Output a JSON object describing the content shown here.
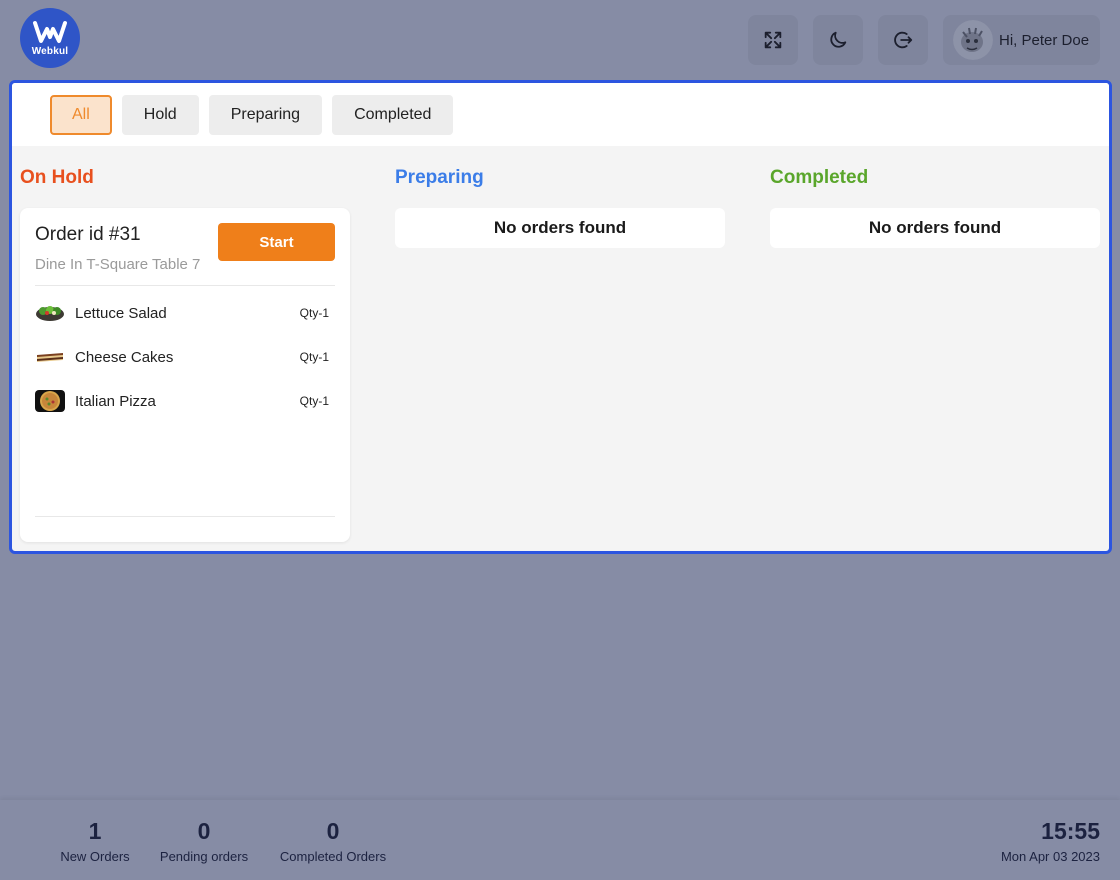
{
  "logo": {
    "text": "Webkul",
    "color": "#2f55c7"
  },
  "header": {
    "buttons": [
      {
        "icon": "fullscreen-icon"
      },
      {
        "icon": "moon-icon"
      },
      {
        "icon": "logout-icon"
      }
    ],
    "user": {
      "greeting": "Hi, Peter Doe",
      "avatar_icon": "user-avatar"
    }
  },
  "tabs": [
    {
      "label": "All",
      "active": true
    },
    {
      "label": "Hold",
      "active": false
    },
    {
      "label": "Preparing",
      "active": false
    },
    {
      "label": "Completed",
      "active": false
    }
  ],
  "columns": {
    "hold": {
      "title": "On Hold",
      "color": "#e8501e"
    },
    "preparing": {
      "title": "Preparing",
      "color": "#3b7de8",
      "empty": "No orders found"
    },
    "completed": {
      "title": "Completed",
      "color": "#5aa62b",
      "empty": "No orders found"
    }
  },
  "order": {
    "id": "Order id #31",
    "subtitle": "Dine In T-Square Table 7",
    "action": "Start",
    "items": [
      {
        "name": "Lettuce Salad",
        "qty": "Qty-1",
        "icon": "salad-thumb"
      },
      {
        "name": "Cheese Cakes",
        "qty": "Qty-1",
        "icon": "cake-thumb"
      },
      {
        "name": "Italian Pizza",
        "qty": "Qty-1",
        "icon": "pizza-thumb"
      }
    ]
  },
  "footer": {
    "stats": [
      {
        "value": "1",
        "label": "New Orders"
      },
      {
        "value": "0",
        "label": "Pending orders"
      },
      {
        "value": "0",
        "label": "Completed Orders"
      }
    ],
    "time": "15:55",
    "date": "Mon Apr 03 2023"
  },
  "colors": {
    "accent": "#ef7f1a",
    "border": "#2c55e0"
  }
}
